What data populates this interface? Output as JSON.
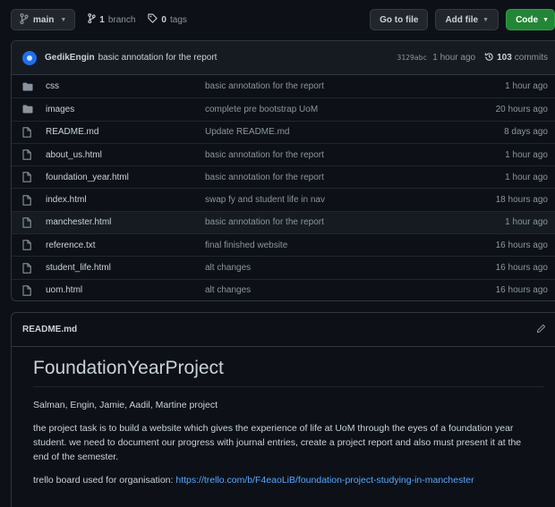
{
  "toolbar": {
    "branch": "main",
    "branch_count": "1",
    "branch_label": "branch",
    "tag_count": "0",
    "tag_label": "tags",
    "go_to_file": "Go to file",
    "add_file": "Add file",
    "code": "Code"
  },
  "commit": {
    "author": "GedikEngin",
    "message": "basic annotation for the report",
    "sha": "3129abc",
    "time": "1 hour ago",
    "count": "103",
    "count_label": "commits"
  },
  "files": [
    {
      "name": "css",
      "type": "folder",
      "message": "basic annotation for the report",
      "time": "1 hour ago"
    },
    {
      "name": "images",
      "type": "folder",
      "message": "complete pre bootstrap UoM",
      "time": "20 hours ago"
    },
    {
      "name": "README.md",
      "type": "file",
      "message": "Update README.md",
      "time": "8 days ago"
    },
    {
      "name": "about_us.html",
      "type": "file",
      "message": "basic annotation for the report",
      "time": "1 hour ago"
    },
    {
      "name": "foundation_year.html",
      "type": "file",
      "message": "basic annotation for the report",
      "time": "1 hour ago"
    },
    {
      "name": "index.html",
      "type": "file",
      "message": "swap fy and student life in nav",
      "time": "18 hours ago"
    },
    {
      "name": "manchester.html",
      "type": "file",
      "message": "basic annotation for the report",
      "time": "1 hour ago"
    },
    {
      "name": "reference.txt",
      "type": "file",
      "message": "final finished website",
      "time": "16 hours ago"
    },
    {
      "name": "student_life.html",
      "type": "file",
      "message": "alt changes",
      "time": "16 hours ago"
    },
    {
      "name": "uom.html",
      "type": "file",
      "message": "alt changes",
      "time": "16 hours ago"
    }
  ],
  "readme": {
    "filename": "README.md",
    "title": "FoundationYearProject",
    "authors": "Salman, Engin, Jamie, Aadil, Martine project",
    "description": "the project task is to build a website which gives the experience of life at UoM through the eyes of a foundation year student. we need to document our progress with journal entries, create a project report and also must present it at the end of the semester.",
    "trello_prefix": "trello board used for organisation: ",
    "trello_link": "https://trello.com/b/F4eaoLiB/foundation-project-studying-in-manchester"
  },
  "icons": {
    "branch": "git-branch-icon",
    "tag": "tag-icon",
    "history": "history-icon",
    "folder": "folder-icon",
    "file": "file-icon",
    "edit": "pencil-icon"
  },
  "colors": {
    "background": "#0d1117",
    "panel": "#161b22",
    "border": "#30363d",
    "text": "#c9d1d9",
    "muted": "#8b949e",
    "link": "#58a6ff",
    "code_button": "#238636",
    "avatar": "#1f6feb"
  }
}
